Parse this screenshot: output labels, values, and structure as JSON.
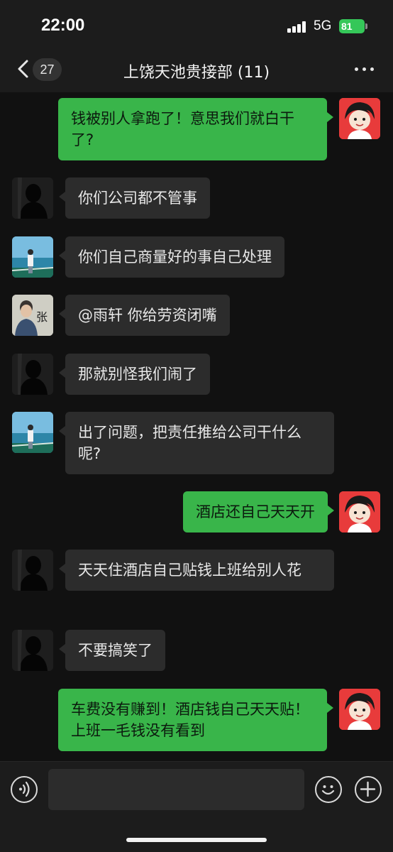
{
  "status_bar": {
    "time": "22:00",
    "network": "5G",
    "battery": "81"
  },
  "nav": {
    "unread_count": "27",
    "title": "上饶天池贵接部 (11)",
    "icons": [
      "chevron-left-icon",
      "more-dots-icon"
    ]
  },
  "messages": [
    {
      "side": "right",
      "sender_avatar": "cartoon-avatar",
      "text": "钱被别人拿跑了！意思我们就白干了?"
    },
    {
      "side": "left",
      "sender_avatar": "silhouette-avatar",
      "text": "你们公司都不管事"
    },
    {
      "side": "left",
      "sender_avatar": "seaside-photo-avatar",
      "text": "你们自己商量好的事自己处理"
    },
    {
      "side": "left",
      "sender_avatar": "portrait-photo-avatar",
      "text": "@雨轩 你给劳资闭嘴"
    },
    {
      "side": "left",
      "sender_avatar": "silhouette-avatar",
      "text": "那就别怪我们闹了"
    },
    {
      "side": "left",
      "sender_avatar": "seaside-photo-avatar",
      "text": "出了问题，把责任推给公司干什么呢?"
    },
    {
      "side": "right",
      "sender_avatar": "cartoon-avatar",
      "text": "酒店还自己天天开"
    },
    {
      "side": "left",
      "sender_avatar": "silhouette-avatar",
      "text": "天天住酒店自己贴钱上班给别人花"
    },
    {
      "side": "left",
      "sender_avatar": "silhouette-avatar",
      "text": "不要搞笑了"
    },
    {
      "side": "right",
      "sender_avatar": "cartoon-avatar",
      "text": "车费没有赚到！酒店钱自己天天贴！上班一毛钱没有看到"
    }
  ],
  "avatar_text": {
    "portrait_label": "张"
  },
  "input_bar": {
    "placeholder": "",
    "icons": [
      "voice-icon",
      "emoji-icon",
      "plus-icon"
    ]
  },
  "colors": {
    "background": "#111111",
    "bar_background": "#1c1c1c",
    "incoming_bubble": "#2c2c2c",
    "outgoing_bubble": "#39b54a",
    "battery": "#35c759"
  }
}
